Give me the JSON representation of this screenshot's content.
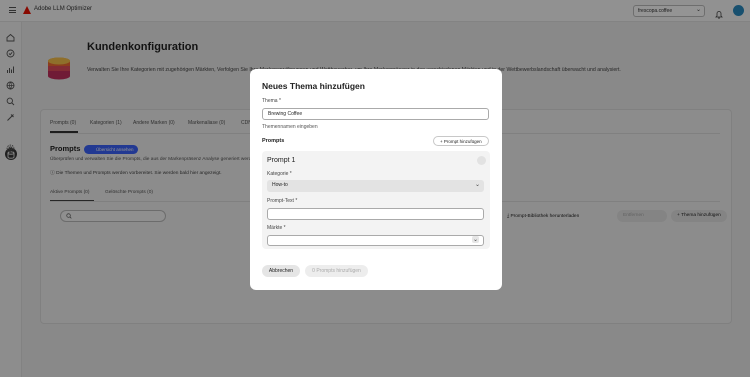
{
  "app": {
    "title": "Adobe LLM Optimizer",
    "org_select": "frescopa.coffee"
  },
  "page": {
    "title": "Kundenkonfiguration",
    "description": "Verwalten Sie Ihre Kategorien mit zugehörigen Märkten, Verfolgen Sie Ihre Markenerwähnungen und Wettbewerber, um Ihre Markenpräsenz in den verschiedenen Märkten und in der Wettbewerbslandschaft überwacht und analysiert."
  },
  "tabs": [
    "Prompts (0)",
    "Kategorien (1)",
    "Andere Marken (0)",
    "Markenaliase (0)",
    "CDN"
  ],
  "prompts_section": {
    "title": "Prompts",
    "badge": "Übersicht ansehen",
    "description": "Überprüfen und verwalten Sie die Prompts, die aus der Markenpräsenz Analyse generiert werden.",
    "info": "Die Themen und Prompts werden vorbereitet. Sie werden bald hier angezeigt.",
    "subtabs": [
      "Aktive Prompts (0)",
      "Gelöschte Prompts (0)"
    ],
    "download_button": "Prompt-Bibliothek herunterladen",
    "delete_button": "Entfernen",
    "add_topic_button": "Thema hinzufügen"
  },
  "modal": {
    "title": "Neues Thema hinzufügen",
    "topic_label": "Thema",
    "topic_value": "Brewing Coffee",
    "topic_helper": "Themennamen eingeben",
    "prompts_heading": "Prompts",
    "add_prompt_button": "Prompt hinzufügen",
    "prompt": {
      "title": "Prompt 1",
      "category_label": "Kategorie",
      "category_value": "How-to",
      "text_label": "Prompt-Text",
      "text_value": "",
      "markets_label": "Märkte",
      "markets_value": ""
    },
    "cancel_button": "Abbrechen",
    "submit_button": "0 Prompts hinzufügen"
  },
  "colors": {
    "brand_red": "#eb1000",
    "accent_blue": "#3b63fb",
    "avatar": "#2a8bc0"
  },
  "icons": [
    "menu-icon",
    "adobe-logo-icon",
    "bell-icon",
    "home-icon",
    "target-icon",
    "chart-icon",
    "globe-icon",
    "search-icon",
    "tools-icon",
    "database-icon",
    "settings-icon"
  ]
}
